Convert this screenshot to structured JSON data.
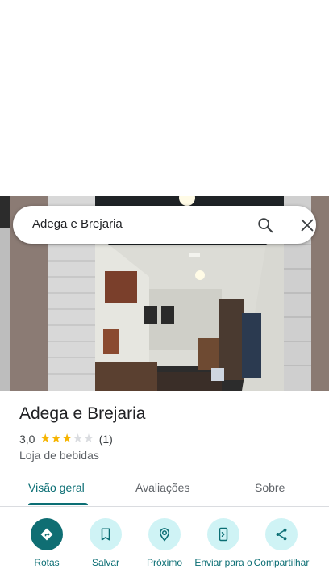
{
  "search": {
    "query": "Adega e Brejaria"
  },
  "place": {
    "title": "Adega e Brejaria",
    "rating": "3,0",
    "rating_fraction": 0.6,
    "review_count": "(1)",
    "category": "Loja de bebidas"
  },
  "tabs": [
    {
      "label": "Visão geral",
      "active": true
    },
    {
      "label": "Avaliações",
      "active": false
    },
    {
      "label": "Sobre",
      "active": false
    }
  ],
  "actions": [
    {
      "label": "Rotas",
      "icon": "directions-icon"
    },
    {
      "label": "Salvar",
      "icon": "bookmark-icon"
    },
    {
      "label": "Próximo",
      "icon": "nearby-icon"
    },
    {
      "label": "Enviar para o",
      "icon": "send-to-phone-icon"
    },
    {
      "label": "Compartilhar",
      "icon": "share-icon"
    }
  ],
  "colors": {
    "accent": "#0b6e74",
    "action_bg": "#cff3f5",
    "star": "#f6b400"
  }
}
